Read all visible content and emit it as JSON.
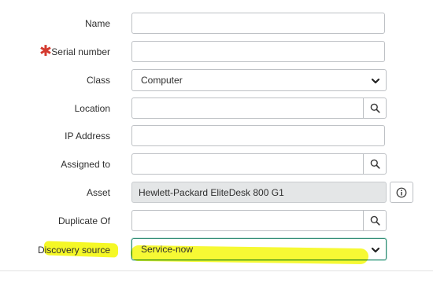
{
  "form": {
    "name_label": "Name",
    "serial_label": "Serial number",
    "class_label": "Class",
    "class_value": "Computer",
    "location_label": "Location",
    "ip_label": "IP Address",
    "assigned_label": "Assigned to",
    "asset_label": "Asset",
    "asset_value": "Hewlett-Packard EliteDesk 800 G1",
    "duplicate_label": "Duplicate Of",
    "discovery_label": "Discovery source",
    "discovery_value": "Service-now",
    "mandatory_marker": "✱"
  },
  "icons": {
    "search": "search-icon",
    "info": "info-icon",
    "dropdown": "chevron-down-icon"
  },
  "colors": {
    "mandatory": "#d43a2f",
    "highlight": "#f5f91e",
    "focus_border": "#2e8b74"
  }
}
